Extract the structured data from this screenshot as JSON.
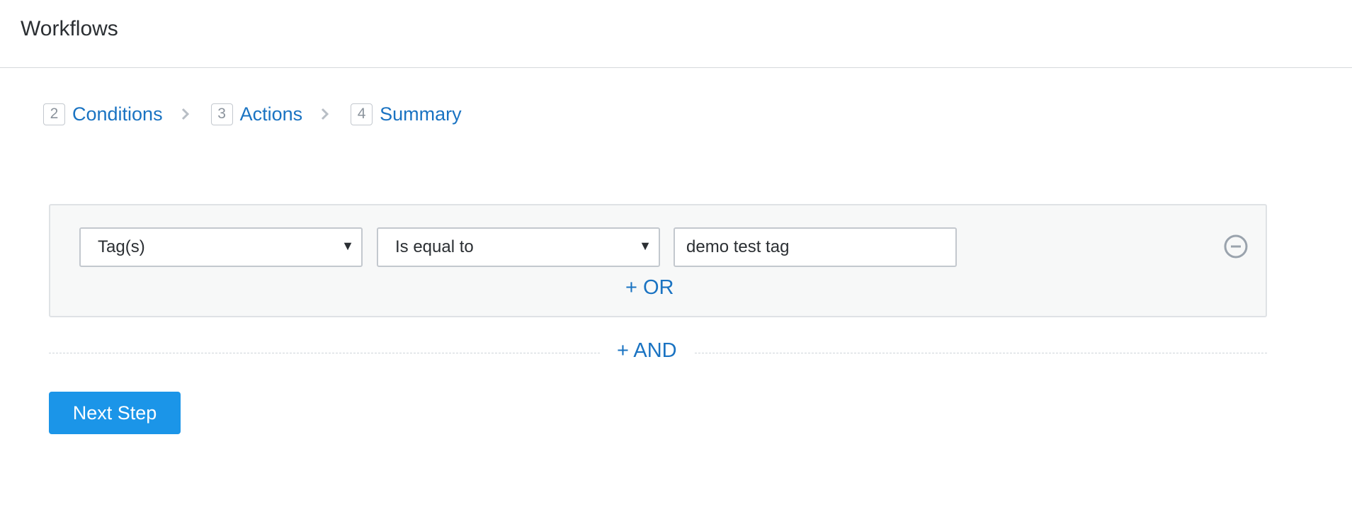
{
  "header": {
    "title": "Workflows"
  },
  "steps": [
    {
      "number": "2",
      "label": "Conditions"
    },
    {
      "number": "3",
      "label": "Actions"
    },
    {
      "number": "4",
      "label": "Summary"
    }
  ],
  "condition": {
    "field": {
      "selected": "Tag(s)"
    },
    "operator": {
      "selected": "Is equal to"
    },
    "value": "demo test tag",
    "or_label": "+ OR"
  },
  "and_label": "+ AND",
  "next_button_label": "Next Step",
  "icons": {
    "step_separator": "chevron-right-icon",
    "dropdown": "caret-down-icon",
    "remove_condition": "minus-circle-icon"
  },
  "colors": {
    "link": "#1a73c2",
    "primary_button": "#1b95e8",
    "panel_background": "#f7f8f8"
  }
}
